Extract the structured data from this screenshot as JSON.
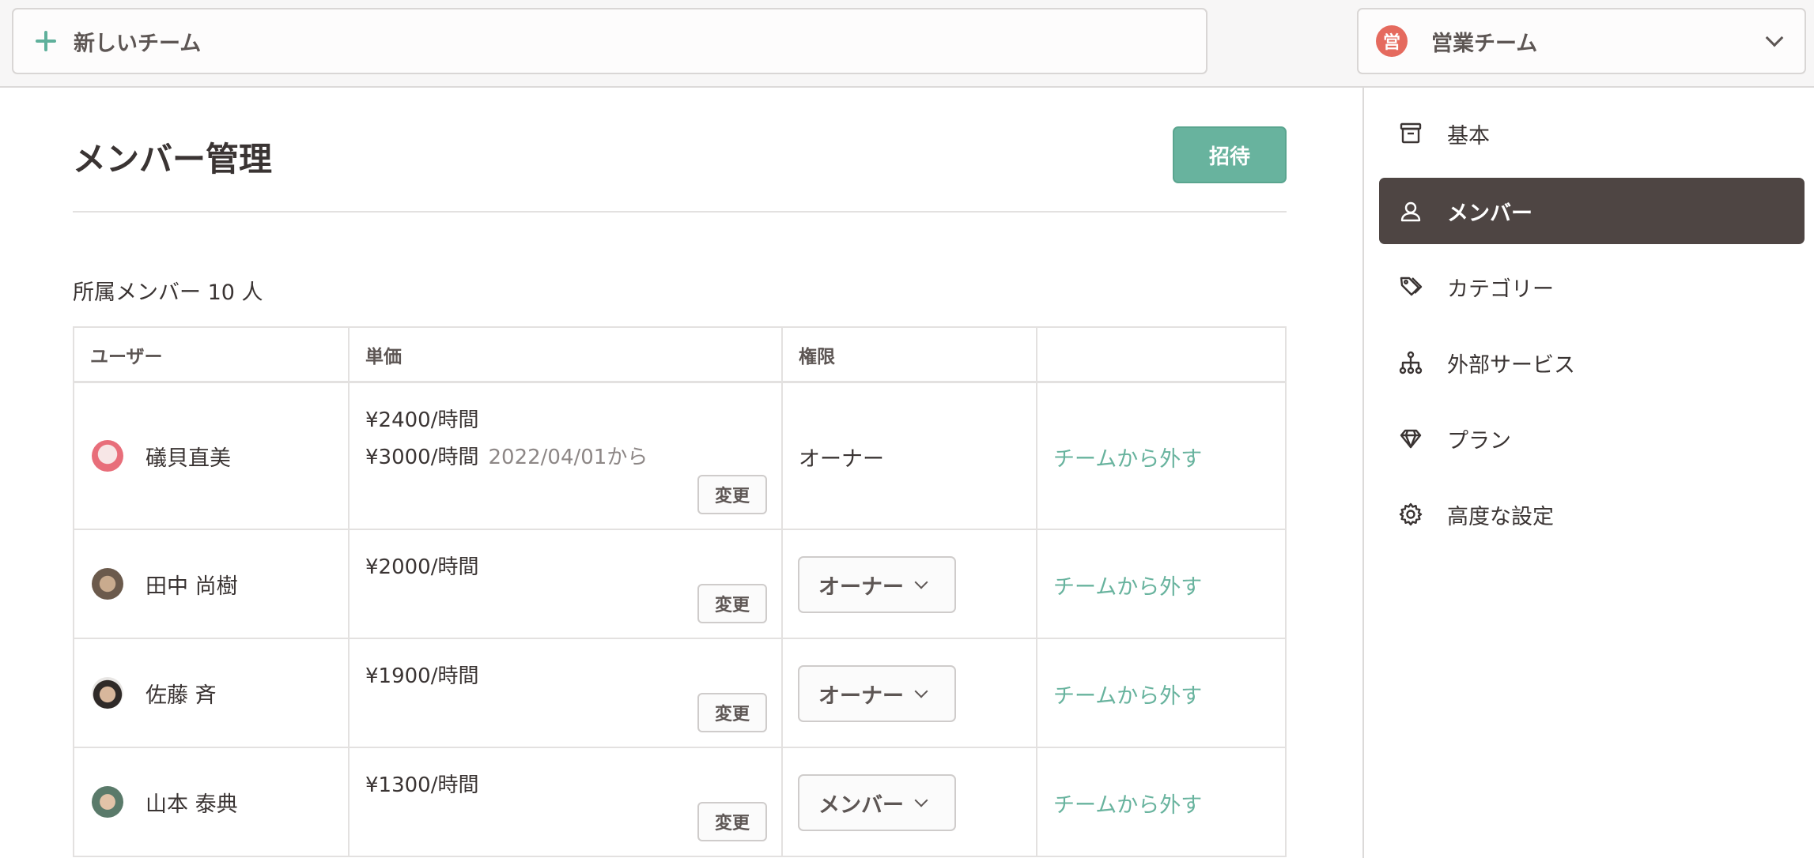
{
  "topbar": {
    "new_team_label": "新しいチーム",
    "team_name": "営業チーム",
    "team_logo_char": "営"
  },
  "sidebar": {
    "items": [
      {
        "label": "基本",
        "icon": "archive-box-icon"
      },
      {
        "label": "メンバー",
        "icon": "user-icon",
        "active": true
      },
      {
        "label": "カテゴリー",
        "icon": "tags-icon"
      },
      {
        "label": "外部サービス",
        "icon": "hierarchy-icon"
      },
      {
        "label": "プラン",
        "icon": "diamond-icon"
      },
      {
        "label": "高度な設定",
        "icon": "gear-icon"
      }
    ]
  },
  "main": {
    "title": "メンバー管理",
    "invite_label": "招待",
    "member_count": "所属メンバー 10 人",
    "table": {
      "headers": [
        "ユーザー",
        "単価",
        "権限",
        ""
      ],
      "rows": [
        {
          "name": "礒貝直美",
          "price": "¥2400/時間",
          "price2": "¥3000/時間",
          "price2_from": "2022/04/01から",
          "change": "変更",
          "role": "オーナー",
          "role_editable": false,
          "remove": "チームから外す"
        },
        {
          "name": "田中 尚樹",
          "price": "¥2000/時間",
          "change": "変更",
          "role": "オーナー",
          "role_editable": true,
          "remove": "チームから外す"
        },
        {
          "name": "佐藤 斉",
          "price": "¥1900/時間",
          "change": "変更",
          "role": "オーナー",
          "role_editable": true,
          "remove": "チームから外す"
        },
        {
          "name": "山本 泰典",
          "price": "¥1300/時間",
          "change": "変更",
          "role": "メンバー",
          "role_editable": true,
          "remove": "チームから外す"
        }
      ]
    }
  },
  "colors": {
    "accent": "#68b39e",
    "sidebar_active_bg": "#4e4543",
    "team_logo": "#e56a5e"
  }
}
